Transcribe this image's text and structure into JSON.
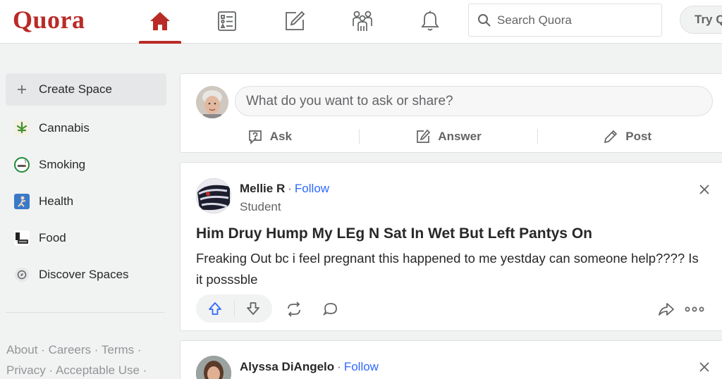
{
  "header": {
    "logo": "Quora",
    "search_placeholder": "Search Quora",
    "try_label": "Try Q",
    "nav": [
      {
        "name": "home-icon",
        "active": true
      },
      {
        "name": "following-icon",
        "active": false
      },
      {
        "name": "answer-icon",
        "active": false
      },
      {
        "name": "spaces-icon",
        "active": false
      },
      {
        "name": "notifications-icon",
        "active": false
      }
    ],
    "accent_color": "#b92b27"
  },
  "sidebar": {
    "items": [
      {
        "label": "Create Space",
        "icon": "plus-icon"
      },
      {
        "label": "Cannabis",
        "icon": "cannabis-space-icon"
      },
      {
        "label": "Smoking",
        "icon": "smoking-space-icon"
      },
      {
        "label": "Health",
        "icon": "health-space-icon"
      },
      {
        "label": "Food",
        "icon": "food-space-icon"
      },
      {
        "label": "Discover Spaces",
        "icon": "compass-icon"
      }
    ],
    "footer": {
      "about": "About",
      "careers": "Careers",
      "terms": "Terms",
      "privacy": "Privacy",
      "acceptable_use": "Acceptable Use",
      "sep": "·"
    }
  },
  "ask_box": {
    "placeholder": "What do you want to ask or share?",
    "ask_label": "Ask",
    "answer_label": "Answer",
    "post_label": "Post"
  },
  "feed": [
    {
      "author": "Mellie R",
      "follow_label": "Follow",
      "credential": "Student",
      "title": "Him Druy Hump My LEg N Sat In Wet But Left Pantys On",
      "body": "Freaking Out bc i feel pregnant this happened to me yestday can someone help???? Is it posssble"
    },
    {
      "author": "Alyssa DiAngelo",
      "follow_label": "Follow"
    }
  ],
  "dot_sep": "·",
  "colors": {
    "link": "#2e69ff",
    "upvote": "#2e69ff",
    "text": "#282829",
    "muted": "#636466"
  }
}
